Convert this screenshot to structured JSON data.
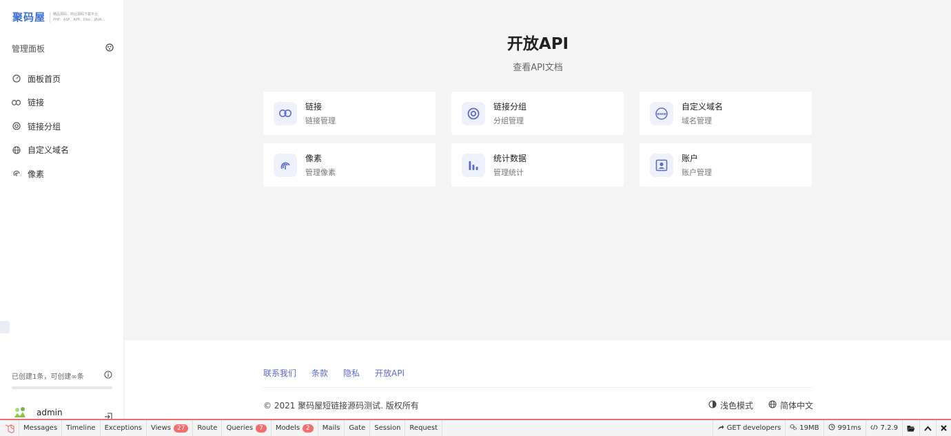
{
  "logo": {
    "text": "聚码屋",
    "tagline1": "精品源码、商业源码下载平台",
    "tagline2": "PHP、ASP、APP、Disc、JAVA…"
  },
  "sidebar": {
    "header": "管理面板",
    "items": [
      {
        "label": "面板首页",
        "icon": "gauge-icon"
      },
      {
        "label": "链接",
        "icon": "link-icon"
      },
      {
        "label": "链接分组",
        "icon": "target-icon"
      },
      {
        "label": "自定义域名",
        "icon": "globe-icon"
      },
      {
        "label": "像素",
        "icon": "fingerprint-icon"
      }
    ],
    "usage_text": "已创建1条，可创建∞条",
    "usage_fraction": 0.0,
    "user_name": "admin"
  },
  "main": {
    "title": "开放API",
    "subtitle": "查看API文档",
    "cards": [
      {
        "title": "链接",
        "desc": "链接管理",
        "icon": "link-icon"
      },
      {
        "title": "链接分组",
        "desc": "分组管理",
        "icon": "target-icon"
      },
      {
        "title": "自定义域名",
        "desc": "域名管理",
        "icon": "www-icon"
      },
      {
        "title": "像素",
        "desc": "管理像素",
        "icon": "fingerprint-icon"
      },
      {
        "title": "统计数据",
        "desc": "管理统计",
        "icon": "bar-chart-icon"
      },
      {
        "title": "账户",
        "desc": "账户管理",
        "icon": "account-icon"
      }
    ]
  },
  "footer": {
    "links": [
      "联系我们",
      "条款",
      "隐私",
      "开放API"
    ],
    "copyright": "© 2021 聚码屋短链接源码测试. 版权所有",
    "theme": "浅色模式",
    "language": "简体中文"
  },
  "debugbar": {
    "tabs": [
      {
        "label": "Messages"
      },
      {
        "label": "Timeline"
      },
      {
        "label": "Exceptions"
      },
      {
        "label": "Views",
        "badge": "27"
      },
      {
        "label": "Route"
      },
      {
        "label": "Queries",
        "badge": "7"
      },
      {
        "label": "Models",
        "badge": "2"
      },
      {
        "label": "Mails"
      },
      {
        "label": "Gate"
      },
      {
        "label": "Session"
      },
      {
        "label": "Request"
      }
    ],
    "request": "GET developers",
    "memory": "19MB",
    "time": "991ms",
    "php_version": "7.2.9"
  },
  "colors": {
    "accent": "#5b6bd1",
    "icon_bg": "#eef0fb",
    "debug_red": "#f26d6d"
  }
}
